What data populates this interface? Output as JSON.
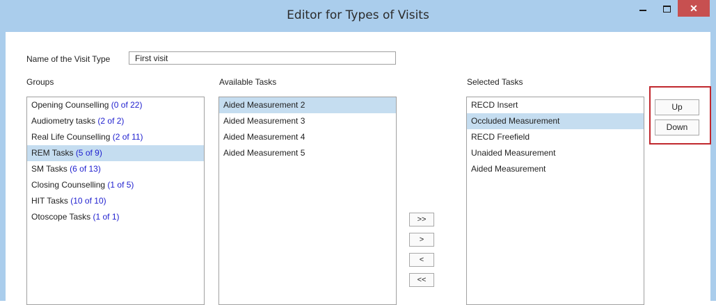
{
  "window": {
    "title": "Editor for Types of Visits",
    "close_glyph": "✕"
  },
  "name_field": {
    "label": "Name of the Visit Type",
    "value": "First visit"
  },
  "groups": {
    "label": "Groups",
    "items": [
      {
        "name": "Opening Counselling",
        "count": "(0 of 22)"
      },
      {
        "name": "Audiometry tasks",
        "count": "(2 of 2)"
      },
      {
        "name": "Real Life Counselling",
        "count": "(2 of 11)"
      },
      {
        "name": "REM Tasks",
        "count": "(5 of 9)"
      },
      {
        "name": "SM Tasks",
        "count": "(6 of 13)"
      },
      {
        "name": "Closing Counselling",
        "count": "(1 of 5)"
      },
      {
        "name": "HIT Tasks",
        "count": "(10 of 10)"
      },
      {
        "name": "Otoscope Tasks",
        "count": "(1 of 1)"
      }
    ]
  },
  "available": {
    "label": "Available Tasks",
    "items": [
      "Aided Measurement 2",
      "Aided Measurement 3",
      "Aided Measurement 4",
      "Aided Measurement 5"
    ]
  },
  "selected": {
    "label": "Selected Tasks",
    "items": [
      "RECD Insert",
      "Occluded Measurement",
      "RECD Freefield",
      "Unaided Measurement",
      "Aided Measurement"
    ]
  },
  "transfer": {
    "add_all": ">>",
    "add": ">",
    "remove": "<",
    "remove_all": "<<"
  },
  "order": {
    "up": "Up",
    "down": "Down"
  },
  "colors": {
    "frame": "#aacdec",
    "selection": "#c5ddf0",
    "count_link": "#1e1ecf",
    "close": "#c75050",
    "highlight_box": "#c0272d"
  }
}
